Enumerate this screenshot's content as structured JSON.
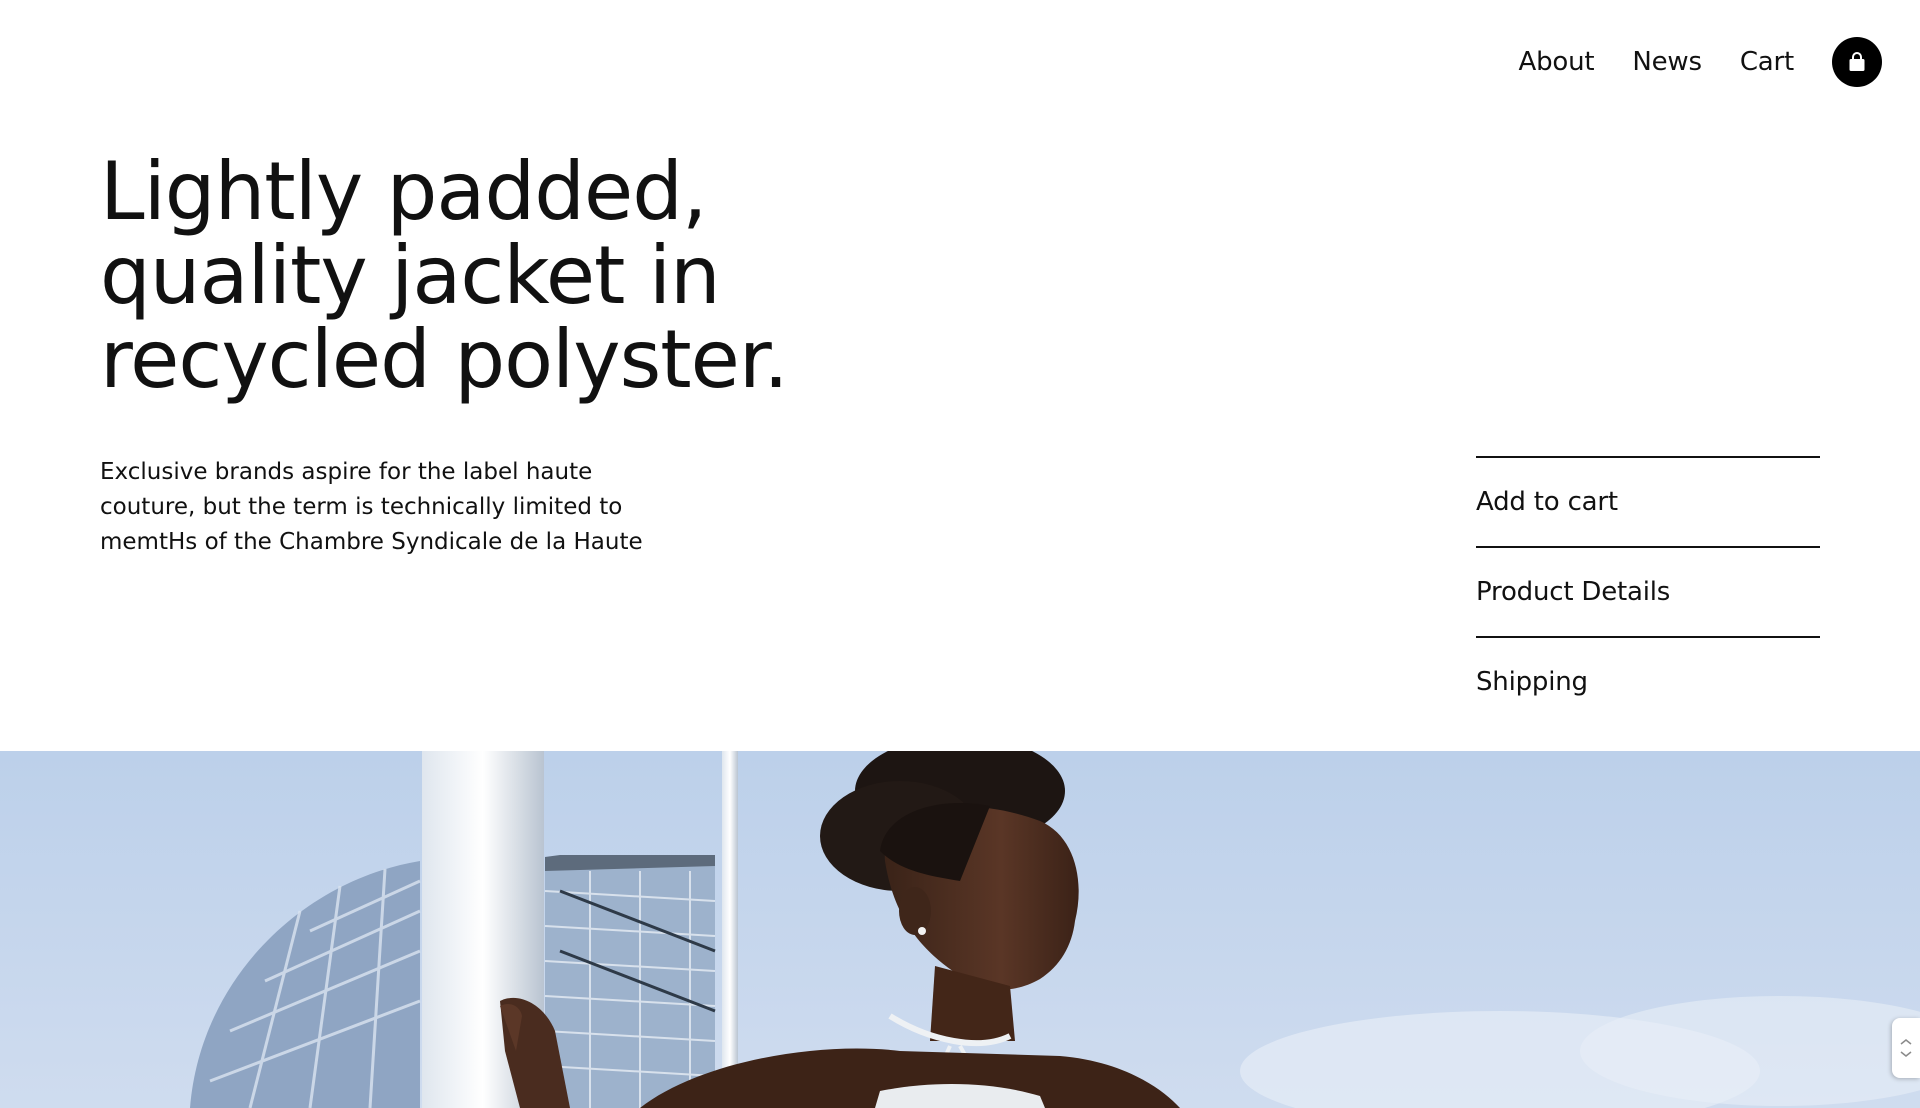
{
  "nav": {
    "links": [
      "About",
      "News",
      "Cart"
    ],
    "bag_icon": "shopping-bag-icon"
  },
  "hero": {
    "headline_lines": [
      "Lightly padded,",
      "quality jacket in",
      "recycled polyster."
    ],
    "description_lines": [
      "Exclusive brands aspire for the label haute",
      "couture, but the term is technically limited to",
      "memtHs of the Chambre Syndicale de la Haute"
    ]
  },
  "actions": [
    "Add to cart",
    "Product Details",
    "Shipping"
  ],
  "image": {
    "description_icon": "model-photo",
    "sky_color": "#c3d5ec"
  },
  "side_tab_icon": "resize-icon"
}
